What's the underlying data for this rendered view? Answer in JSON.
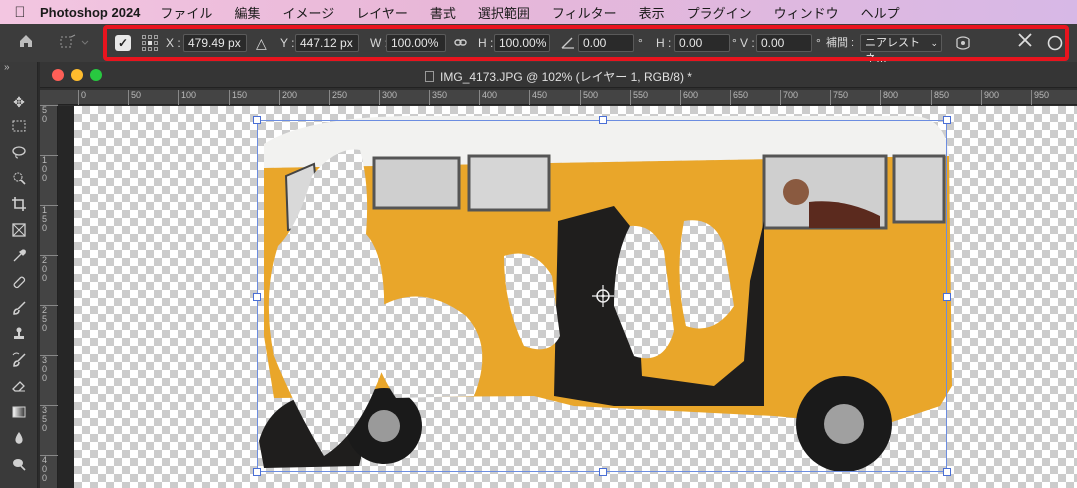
{
  "menubar": {
    "app_name": "Photoshop 2024",
    "items": [
      "ファイル",
      "編集",
      "イメージ",
      "レイヤー",
      "書式",
      "選択範囲",
      "フィルター",
      "表示",
      "プラグイン",
      "ウィンドウ",
      "ヘルプ"
    ]
  },
  "options": {
    "x_label": "X :",
    "x_value": "479.49 px",
    "y_label": "Y :",
    "y_value": "447.12 px",
    "w_label": "W :",
    "w_value": "100.00%",
    "h_label": "H :",
    "h_value": "100.00%",
    "angle_value": "0.00",
    "angle_unit": "°",
    "hskew_label": "H :",
    "hskew_value": "0.00",
    "hskew_unit": "°",
    "vskew_label": "V :",
    "vskew_value": "0.00",
    "vskew_unit": "°",
    "interp_label": "補間 :",
    "interp_value": "ニアレストネ…",
    "highlight_color": "#e8141e"
  },
  "document": {
    "title": "IMG_4173.JPG @ 102% (レイヤー 1, RGB/8) *"
  },
  "rulers": {
    "horizontal": [
      "0",
      "50",
      "100",
      "150",
      "200",
      "250",
      "300",
      "350",
      "400",
      "450",
      "500",
      "550",
      "600",
      "650",
      "700",
      "750",
      "800",
      "850",
      "900",
      "950"
    ],
    "vertical": [
      "5 0",
      "1 0 0",
      "1 5 0",
      "2 0 0",
      "2 5 0",
      "3 0 0",
      "3 5 0",
      "4 0 0",
      "4 5 0",
      "5 0 0",
      "5 5 0"
    ]
  },
  "image": {
    "description_icons": [
      "van-body",
      "van-roof",
      "driver"
    ],
    "van_color": "#e9a62a",
    "roof_color": "#f2f2f0"
  }
}
